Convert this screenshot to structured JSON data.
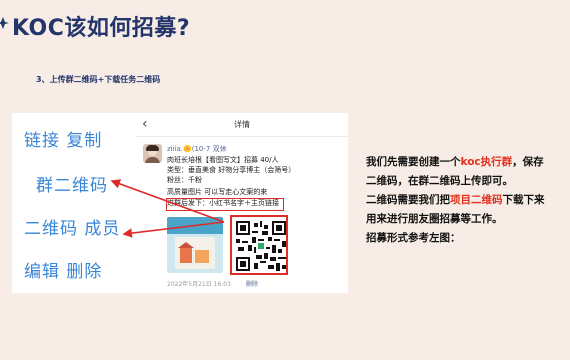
{
  "slide": {
    "title": "KOC该如何招募?",
    "step_heading": "3、上传群二维码+下载任务二维码"
  },
  "menu_labels": {
    "copy_link": "链接  复制",
    "group_qrcode": "群二维码",
    "qrcode_member": "二维码 成员",
    "edit_delete": "编辑 删除"
  },
  "post": {
    "topbar_title": "详情",
    "back_icon": "chevron-left-icon",
    "author": "ziiia.🌼(10-7 双休",
    "lines": [
      "肉班长培根【看图写文】招募 40/人",
      "类型：垂直美食 好物分享博主（会筛号）",
      "粉丝：千粉",
      "高质量图片 可以写走心文案的来",
      "进群后发下：小红书名字＋主页链接"
    ],
    "time": "2022年5月21日 16:03",
    "delete_label": "删除"
  },
  "description": {
    "p1_before": "我们先需要创建一个",
    "p1_highlight": "koc执行群",
    "p1_after": "，保存",
    "p1_line2": "二维码，在群二维码上传即可。",
    "p2_before": "二维码需要我们把",
    "p2_highlight": "项目二维码",
    "p2_after": "下载下来",
    "p2_line2": "用来进行朋友圈招募等工作。",
    "p3": "招募形式参考左图："
  },
  "colors": {
    "title": "#23356b",
    "label_blue": "#3a86d6",
    "highlight_red": "#e0301e",
    "background": "#f8ede6"
  }
}
